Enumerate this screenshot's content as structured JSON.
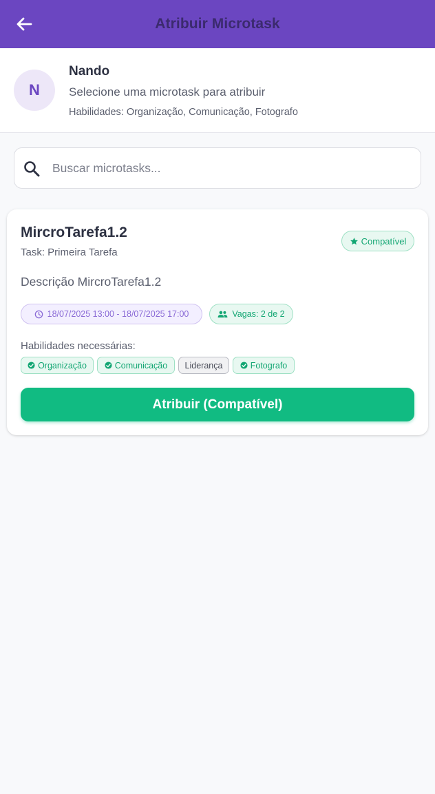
{
  "appbar": {
    "title": "Atribuir Microtask",
    "back_icon": "arrow-left-icon"
  },
  "profile": {
    "initial": "N",
    "name": "Nando",
    "subtitle": "Selecione uma microtask para atribuir",
    "skills_text": "Habilidades: Organização, Comunicação, Fotografo"
  },
  "search": {
    "placeholder": "Buscar microtasks...",
    "value": "",
    "icon": "search-icon"
  },
  "microtasks": [
    {
      "title": "MircroTarefa1.2",
      "task": "Task: Primeira Tarefa",
      "badge": "Compatível",
      "description": "Descrição MircroTarefa1.2",
      "date_range": "18/07/2025 13:00 - 18/07/2025 17:00",
      "vagas": "Vagas: 2 de 2",
      "skills_label": "Habilidades necessárias:",
      "skills": [
        {
          "name": "Organização",
          "matched": true
        },
        {
          "name": "Comunicação",
          "matched": true
        },
        {
          "name": "Liderança",
          "matched": false
        },
        {
          "name": "Fotografo",
          "matched": true
        }
      ],
      "action_label": "Atribuir (Compatível)"
    }
  ],
  "colors": {
    "primary": "#6b46c1",
    "accent_green": "#11bb82",
    "background": "#f8f9fb"
  }
}
